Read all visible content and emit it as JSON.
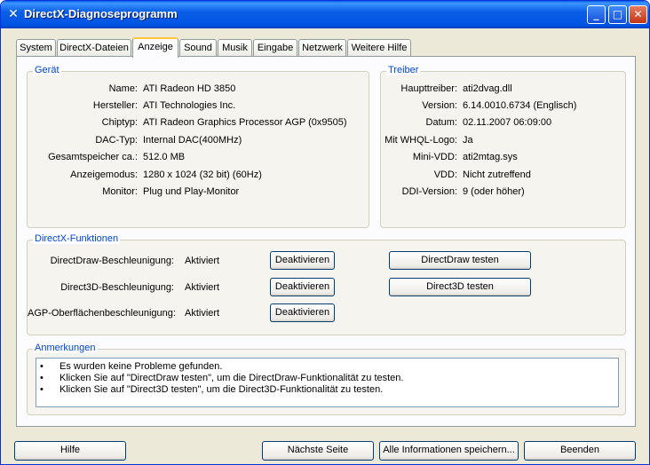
{
  "window": {
    "title": "DirectX-Diagnoseprogramm",
    "icon": "x-icon"
  },
  "tabs": [
    "System",
    "DirectX-Dateien",
    "Anzeige",
    "Sound",
    "Musik",
    "Eingabe",
    "Netzwerk",
    "Weitere Hilfe"
  ],
  "active_tab": "Anzeige",
  "device": {
    "title": "Gerät",
    "rows": [
      {
        "label": "Name:",
        "value": "ATI Radeon HD 3850"
      },
      {
        "label": "Hersteller:",
        "value": "ATI Technologies Inc."
      },
      {
        "label": "Chiptyp:",
        "value": "ATI Radeon Graphics Processor AGP (0x9505)"
      },
      {
        "label": "DAC-Typ:",
        "value": "Internal DAC(400MHz)"
      },
      {
        "label": "Gesamtspeicher ca.:",
        "value": "512.0 MB"
      },
      {
        "label": "Anzeigemodus:",
        "value": "1280 x 1024 (32 bit) (60Hz)"
      },
      {
        "label": "Monitor:",
        "value": "Plug und Play-Monitor"
      }
    ]
  },
  "driver": {
    "title": "Treiber",
    "rows": [
      {
        "label": "Haupttreiber:",
        "value": "ati2dvag.dll"
      },
      {
        "label": "Version:",
        "value": "6.14.0010.6734 (Englisch)"
      },
      {
        "label": "Datum:",
        "value": "02.11.2007 06:09:00"
      },
      {
        "label": "Mit WHQL-Logo:",
        "value": "Ja"
      },
      {
        "label": "Mini-VDD:",
        "value": "ati2mtag.sys"
      },
      {
        "label": "VDD:",
        "value": "Nicht zutreffend"
      },
      {
        "label": "DDI-Version:",
        "value": "9 (oder höher)"
      }
    ]
  },
  "features": {
    "title": "DirectX-Funktionen",
    "rows": [
      {
        "label": "DirectDraw-Beschleunigung:",
        "status": "Aktiviert",
        "button": "Deaktivieren",
        "test": "DirectDraw testen"
      },
      {
        "label": "Direct3D-Beschleunigung:",
        "status": "Aktiviert",
        "button": "Deaktivieren",
        "test": "Direct3D testen"
      },
      {
        "label": "AGP-Oberflächenbeschleunigung:",
        "status": "Aktiviert",
        "button": "Deaktivieren"
      }
    ]
  },
  "notes": {
    "title": "Anmerkungen",
    "items": [
      "Es wurden keine Probleme gefunden.",
      "Klicken Sie auf \"DirectDraw testen\", um die DirectDraw-Funktionalität zu testen.",
      "Klicken Sie auf \"Direct3D testen\", um die Direct3D-Funktionalität zu testen."
    ]
  },
  "footer": {
    "help": "Hilfe",
    "next": "Nächste Seite",
    "save": "Alle Informationen speichern...",
    "exit": "Beenden"
  },
  "colors": {
    "title_bar": "#0054e3",
    "group_title": "#0046d5",
    "dialog_bg": "#ece9d8",
    "active_tab_accent": "#ffc83c"
  }
}
